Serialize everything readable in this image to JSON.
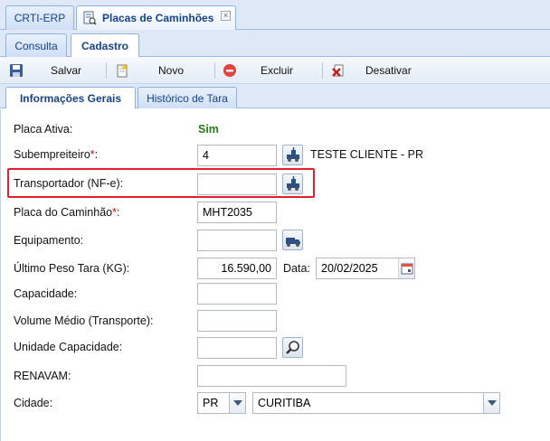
{
  "top_tabs": [
    {
      "label": "CRTI-ERP"
    },
    {
      "label": "Placas de Caminhões",
      "close": "×"
    }
  ],
  "sub_tabs": [
    {
      "label": "Consulta"
    },
    {
      "label": "Cadastro"
    }
  ],
  "toolbar": {
    "save_label": "Salvar",
    "new_label": "Novo",
    "delete_label": "Excluir",
    "deactivate_label": "Desativar"
  },
  "inner_tabs": [
    {
      "label": "Informações Gerais"
    },
    {
      "label": "Histórico de Tara"
    }
  ],
  "form": {
    "placa_ativa": {
      "label": "Placa Ativa:",
      "value": "Sim"
    },
    "subempreiteiro": {
      "label": "Subempreiteiro",
      "required": "*",
      "suffix": ":",
      "value": "4",
      "desc": "TESTE CLIENTE - PR"
    },
    "transportador": {
      "label": "Transportador (NF-e):",
      "value": ""
    },
    "placa_caminhao": {
      "label": "Placa do Caminhão",
      "required": "*",
      "suffix": ":",
      "value": "MHT2035"
    },
    "equipamento": {
      "label": "Equipamento:",
      "value": ""
    },
    "ultimo_peso": {
      "label": "Último Peso Tara (KG):",
      "value": "16.590,00",
      "date_label": "Data:",
      "date_value": "20/02/2025"
    },
    "capacidade": {
      "label": "Capacidade:",
      "value": ""
    },
    "volume_medio": {
      "label": "Volume Médio (Transporte):",
      "value": ""
    },
    "unidade_capacidade": {
      "label": "Unidade Capacidade:",
      "value": ""
    },
    "renavam": {
      "label": "RENAVAM:",
      "value": ""
    },
    "cidade": {
      "label": "Cidade:",
      "uf": "PR",
      "city": "CURITIBA"
    }
  },
  "colors": {
    "accent": "#15428b",
    "active_value": "#2a7a1a",
    "highlight": "#e0202d",
    "required": "#dd0000"
  }
}
